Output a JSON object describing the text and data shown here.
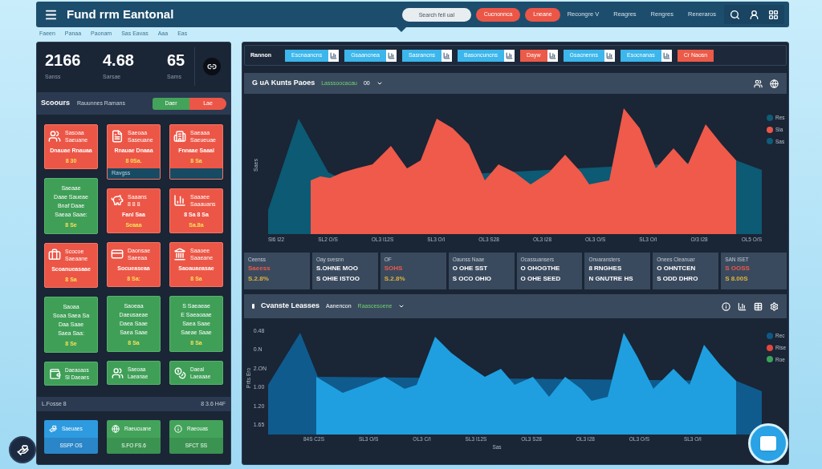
{
  "top_bar": {
    "title": "Fund rrm Eantonal",
    "search": {
      "placeholder": "Search feil ual"
    },
    "buttons": [
      "Cucnonnca",
      "Lneane"
    ],
    "links": [
      "Recongre V",
      "Reagres",
      "Rengres",
      "Reneraros"
    ]
  },
  "breadcrumb": [
    "Faeen",
    "Panaa",
    "Paonam",
    "Sas Eavas",
    "Aaa",
    "Eas"
  ],
  "summary_panel": {
    "stats": [
      {
        "value": "2166",
        "label": "Sanss"
      },
      {
        "value": "4.68",
        "label": "Sarsae"
      },
      {
        "value": "65",
        "label": "Sams"
      }
    ],
    "filter": {
      "title": "Scoours",
      "subtitle": "Rauunnes Ramans",
      "segments": [
        {
          "label": "Daer",
          "kind": "gain"
        },
        {
          "label": "Lae",
          "kind": "loss"
        }
      ]
    },
    "tiles": [
      {
        "kind": "alert",
        "lines": [
          "Sasoaa",
          "Saeuane"
        ],
        "title": "Dnauae Rnauaa",
        "note": "8 30",
        "footer_band": false
      },
      {
        "kind": "alert",
        "lines": [
          "Saeoaa",
          "Saseuane"
        ],
        "title": "Rnauae Dnaaa",
        "note": "8 0Sa.",
        "footer_band": true,
        "footer": "Ravgss"
      },
      {
        "kind": "alert",
        "lines": [
          "Saeaaa",
          "Saeueuae"
        ],
        "title": "Fnnaae Saaal",
        "note": "8 Sa",
        "footer_band": true
      },
      {
        "kind": "ok",
        "lines": [
          "Saeaae",
          "Daae Saueae",
          "Bnaf Daae",
          "Saeaa Saae:"
        ],
        "note": "8 Se"
      },
      {
        "kind": "alert",
        "lines": [
          "Saaans",
          "8 8 8"
        ],
        "title": "Fanl Saa",
        "note": "Seaaa"
      },
      {
        "kind": "alert",
        "lines": [
          "Saaaee",
          "Saaauans"
        ],
        "title": "8 Sa 8 Sa",
        "note": "Sa.8a"
      },
      {
        "kind": "alert",
        "lines": [
          "Scocoe",
          "Saeaane"
        ],
        "title": "Scoanueasaae",
        "note": "8 Sa"
      },
      {
        "kind": "alert",
        "lines": [
          "Daonsae",
          "Saeeaa"
        ],
        "title": "Socueaseaa",
        "note": "8 Sa:"
      },
      {
        "kind": "alert",
        "lines": [
          "Saaoee",
          "Saaeane"
        ],
        "title": "Saoauaeasae",
        "note": "8 Sa"
      },
      {
        "kind": "ok",
        "lines": [
          "Saoaa",
          "Soaa Saea Sa",
          "Daa Saae",
          "Saea Saa:"
        ],
        "note": "8 Se"
      },
      {
        "kind": "ok",
        "lines": [
          "Saoeaa",
          "Daeusaeae",
          "Daea Saae",
          "Saea Saae"
        ],
        "note": "8 Sa"
      },
      {
        "kind": "ok",
        "lines": [
          "S Saeaeae",
          "E Saeaoaae",
          "Saea Saae",
          "Saeae Saae"
        ],
        "note": "8 Sa"
      },
      {
        "kind": "compact",
        "lines": [
          "Daeaoaos",
          "Sl Daeaes"
        ]
      },
      {
        "kind": "compact",
        "lines": [
          "Saeoaa",
          "Laeanae"
        ]
      },
      {
        "kind": "compact",
        "lines": [
          "Daeal",
          "Laeaaae"
        ]
      }
    ],
    "section": {
      "left": "L.Fosse 8",
      "right": "8 3.6 H4F"
    },
    "bottom_tiles": [
      {
        "kind": "info",
        "label": "Saeuaes",
        "value": "SSFP OS"
      },
      {
        "kind": "ok",
        "label": "Raeucuane",
        "value": "S.FO FS.6"
      },
      {
        "kind": "ok",
        "label": "Raeouas",
        "value": "SFCT SS"
      }
    ]
  },
  "main_panel": {
    "filters": {
      "label": "Rannon",
      "chips": [
        {
          "label": "Escnaancns",
          "kind": "info",
          "has_icon": true
        },
        {
          "label": "Gsaancnea",
          "kind": "info",
          "has_icon": true
        },
        {
          "label": "Sasrancns",
          "kind": "info",
          "has_icon": true
        },
        {
          "label": "Basoncuncns",
          "kind": "info",
          "has_icon": true
        },
        {
          "label": "Dayw",
          "kind": "alert",
          "has_icon": true
        },
        {
          "label": "Gsacnenns",
          "kind": "info",
          "has_icon": true
        },
        {
          "label": "Esocnanas",
          "kind": "info",
          "has_icon": true
        },
        {
          "label": "Cr Naosn",
          "kind": "alert",
          "has_icon": false
        }
      ]
    },
    "top_chart": {
      "kind": "alert",
      "title": "G uA Kunts Paoes",
      "header_items": [
        {
          "text": "Lasssoocacau",
          "kind": "accent"
        },
        {
          "text": "00",
          "kind": "plain"
        }
      ],
      "y_label": "Saes",
      "x_labels": [
        "Sl6 I22",
        "SL2 O/S",
        "OL3 I12S",
        "SL3 O/I",
        "OL3 S28",
        "OL3 I28",
        "OL3 O/S",
        "SL3 O/I",
        "O/3 I28",
        "OL5 O/S"
      ],
      "legend": [
        {
          "label": "Res",
          "color": "#0e5c78"
        },
        {
          "label": "Sia",
          "color": "#ec5646"
        },
        {
          "label": "Sas",
          "color": "#0e5c78"
        }
      ]
    },
    "metrics": [
      {
        "label": "Ceenss",
        "lines": [
          {
            "text": "Saeess",
            "kind": "alert"
          },
          {
            "text": "S.2.8%",
            "kind": "warn"
          }
        ]
      },
      {
        "label": "Oay svesnn",
        "lines": [
          {
            "text": "S.OHNE MOO",
            "kind": "plain"
          },
          {
            "text": "S OHIE ISTOO",
            "kind": "plain"
          }
        ]
      },
      {
        "label": "OF",
        "lines": [
          {
            "text": "SOHS",
            "kind": "alert"
          },
          {
            "text": "S.2.8%",
            "kind": "warn"
          }
        ]
      },
      {
        "label": "Oaunss Naae",
        "lines": [
          {
            "text": "O OHE SST",
            "kind": "plain"
          },
          {
            "text": "S OCO OHIO",
            "kind": "plain"
          }
        ]
      },
      {
        "label": "Ocassuansers",
        "lines": [
          {
            "text": "O OHOGTHE",
            "kind": "plain"
          },
          {
            "text": "O OHE SEED",
            "kind": "plain"
          }
        ]
      },
      {
        "label": "Onvaransters",
        "lines": [
          {
            "text": "8 RNGHES",
            "kind": "plain"
          },
          {
            "text": "N GNUTRE HS",
            "kind": "plain"
          }
        ]
      },
      {
        "label": "Onees Cleanuar",
        "lines": [
          {
            "text": "O OHNTCEN",
            "kind": "plain"
          },
          {
            "text": "S ODD DHRO",
            "kind": "plain"
          }
        ]
      },
      {
        "label": "SAN ISET",
        "lines": [
          {
            "text": "S OOSS",
            "kind": "alert"
          },
          {
            "text": "S 8.00S",
            "kind": "warn"
          }
        ]
      }
    ],
    "bottom_chart": {
      "kind": "info",
      "title": "Cvanste Leasses",
      "header_items": [
        {
          "text": "Aanencon",
          "kind": "plain"
        },
        {
          "text": "Raascesoene",
          "kind": "accent"
        }
      ],
      "y_label": "Prlts Ero",
      "y_ticks": [
        "0.48",
        "0.N",
        "2.ON",
        "1.00",
        "1.20",
        "1.65"
      ],
      "x_labels": [
        "84S C2S",
        "SL3 O/S",
        "OL3 C/I",
        "SL3 I12S",
        "OL3 S28",
        "OL3 I28",
        "OL3 O/S",
        "SL3 O/I"
      ],
      "x_title": "Sas",
      "legend": [
        {
          "label": "Rec",
          "color": "#0b5a86"
        },
        {
          "label": "Rise",
          "color": "#e2483b"
        },
        {
          "label": "Roe",
          "color": "#3aa35a"
        }
      ]
    }
  }
}
